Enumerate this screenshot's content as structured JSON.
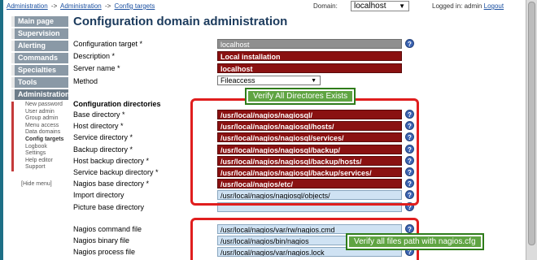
{
  "breadcrumb": [
    "Administration",
    "Administration",
    "Config targets"
  ],
  "breadcrumb_sep": "->",
  "domain": {
    "label": "Domain:",
    "value": "localhost"
  },
  "login": {
    "text": "Logged in: admin",
    "logout": "Logout"
  },
  "sidebar": {
    "main": [
      "Main page",
      "Supervision",
      "Alerting",
      "Commands",
      "Specialties",
      "Tools"
    ],
    "active": "Administration",
    "sub": [
      {
        "label": "New password",
        "bold": false
      },
      {
        "label": "User admin",
        "bold": false
      },
      {
        "label": "Group admin",
        "bold": false
      },
      {
        "label": "Menu access",
        "bold": false
      },
      {
        "label": "Data domains",
        "bold": false
      },
      {
        "label": "Config targets",
        "bold": true
      },
      {
        "label": "Logbook",
        "bold": false
      },
      {
        "label": "Settings",
        "bold": false
      },
      {
        "label": "Help editor",
        "bold": false
      },
      {
        "label": "Support",
        "bold": false
      }
    ],
    "hide_menu": "[Hide menu]"
  },
  "page_title": "Configuration domain administration",
  "help_glyph": "?",
  "general_fields": [
    {
      "label": "Configuration target *",
      "value": "localhost",
      "style": "gray"
    },
    {
      "label": "Description *",
      "value": "Local installation",
      "style": "red"
    },
    {
      "label": "Server name *",
      "value": "localhost",
      "style": "red"
    }
  ],
  "method": {
    "label": "Method",
    "value": "Fileaccess"
  },
  "directories_heading": "Configuration directories",
  "directory_fields": [
    {
      "label": "Base directory *",
      "value": "/usr/local/nagios/nagiosql/",
      "style": "red"
    },
    {
      "label": "Host directory *",
      "value": "/usr/local/nagios/nagiosql/hosts/",
      "style": "red"
    },
    {
      "label": "Service directory *",
      "value": "/usr/local/nagios/nagiosql/services/",
      "style": "red"
    },
    {
      "label": "Backup directory *",
      "value": "/usr/local/nagios/nagiosql/backup/",
      "style": "red"
    },
    {
      "label": "Host backup directory *",
      "value": "/usr/local/nagios/nagiosql/backup/hosts/",
      "style": "red"
    },
    {
      "label": "Service backup directory *",
      "value": "/usr/local/nagios/nagiosql/backup/services/",
      "style": "red"
    },
    {
      "label": "Nagios base directory *",
      "value": "/usr/local/nagios/etc/",
      "style": "red"
    },
    {
      "label": "Import directory",
      "value": "/usr/local/nagios/nagiosql/objects/",
      "style": "blue"
    },
    {
      "label": "Picture base directory",
      "value": "",
      "style": "blue"
    }
  ],
  "file_fields": [
    {
      "label": "Nagios command file",
      "value": "/usr/local/nagios/var/rw/nagios.cmd",
      "style": "blue"
    },
    {
      "label": "Nagios binary file",
      "value": "/usr/local/nagios/bin/nagios",
      "style": "blue"
    },
    {
      "label": "Nagios process file",
      "value": "/usr/local/nagios/var/nagios.lock",
      "style": "blue"
    }
  ],
  "annotations": {
    "directories_note": "Verify All Directores Exists",
    "files_note": "Verify all files path with nagios.cfg",
    "box_color": "#e01e1e",
    "note_color": "#5fa442"
  }
}
